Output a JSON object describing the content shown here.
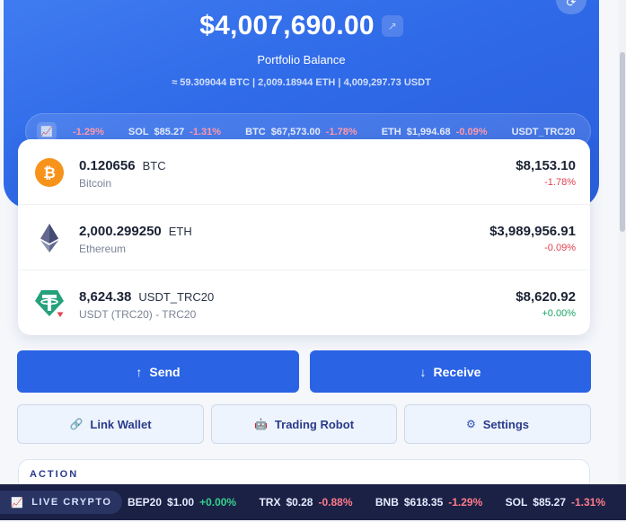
{
  "hero": {
    "balance": "$4,007,690.00",
    "label": "Portfolio Balance",
    "equivalent": "≈ 59.309044 BTC | 2,009.18944 ETH | 4,009,297.73 USDT",
    "trend_icon": "trend-up-icon",
    "top_icon": "refresh-icon"
  },
  "ticker": [
    {
      "symbol": "",
      "price": "",
      "change": "-1.29%"
    },
    {
      "symbol": "SOL",
      "price": "$85.27",
      "change": "-1.31%"
    },
    {
      "symbol": "BTC",
      "price": "$67,573.00",
      "change": "-1.78%"
    },
    {
      "symbol": "ETH",
      "price": "$1,994.68",
      "change": "-0.09%"
    },
    {
      "symbol": "USDT_TRC20",
      "price": "",
      "change": ""
    }
  ],
  "assets": [
    {
      "amount": "0.120656",
      "ticker": "BTC",
      "name": "Bitcoin",
      "usd": "$8,153.10",
      "change": "-1.78%",
      "dir": "neg",
      "icon": "bitcoin-icon",
      "color": "#f7931a"
    },
    {
      "amount": "2,000.299250",
      "ticker": "ETH",
      "name": "Ethereum",
      "usd": "$3,989,956.91",
      "change": "-0.09%",
      "dir": "neg",
      "icon": "ethereum-icon",
      "color": "#62688f"
    },
    {
      "amount": "8,624.38",
      "ticker": "USDT_TRC20",
      "name": "USDT (TRC20) - TRC20",
      "usd": "$8,620.92",
      "change": "+0.00%",
      "dir": "pos",
      "icon": "tether-icon",
      "color": "#26a17b"
    }
  ],
  "actions": {
    "send": "Send",
    "receive": "Receive",
    "link_wallet": "Link Wallet",
    "trading_robot": "Trading Robot",
    "settings": "Settings",
    "section_title": "ACTION"
  },
  "live": {
    "badge": "LIVE CRYPTO",
    "items": [
      {
        "symbol": "BEP20",
        "price": "$1.00",
        "change": "+0.00%",
        "dir": "pos"
      },
      {
        "symbol": "TRX",
        "price": "$0.28",
        "change": "-0.88%",
        "dir": "neg"
      },
      {
        "symbol": "BNB",
        "price": "$618.35",
        "change": "-1.29%",
        "dir": "neg"
      },
      {
        "symbol": "SOL",
        "price": "$85.27",
        "change": "-1.31%",
        "dir": "neg"
      }
    ]
  },
  "colors": {
    "accent": "#2a63e4",
    "negative": "#e0424f",
    "positive": "#1aa566",
    "bar": "#1a2145"
  }
}
